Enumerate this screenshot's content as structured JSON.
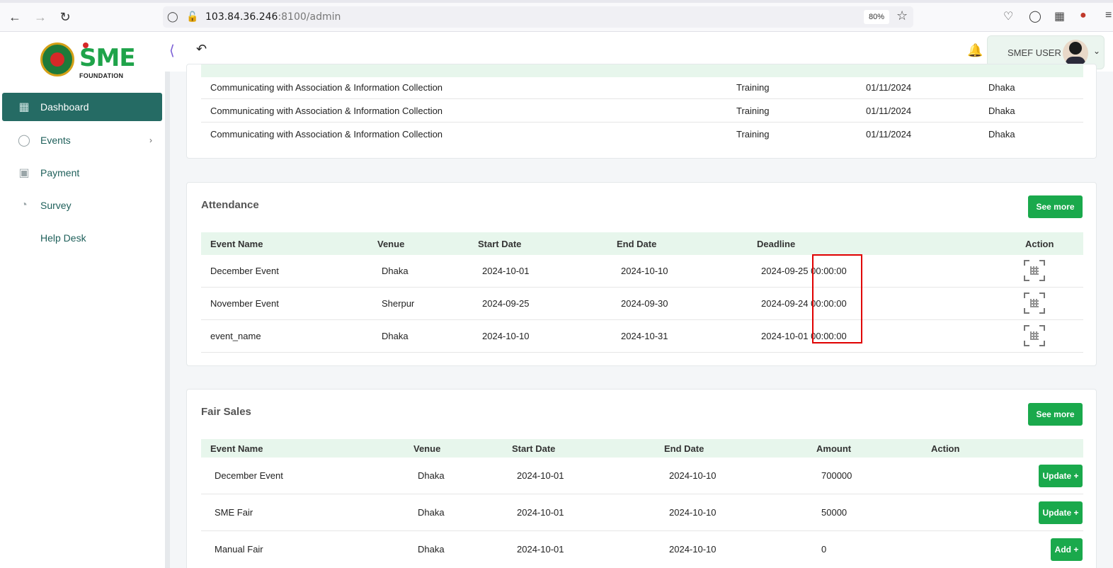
{
  "browser": {
    "url_host": "103.84.36.246",
    "url_rest": ":8100/admin",
    "zoom": "80%"
  },
  "sidebar": {
    "logo_text": "SME",
    "logo_sub": "FOUNDATION",
    "items": [
      {
        "label": "Dashboard",
        "icon": "grid-icon"
      },
      {
        "label": "Events",
        "icon": "lock-icon"
      },
      {
        "label": "Payment",
        "icon": "money-icon"
      },
      {
        "label": "Survey",
        "icon": "pie-chart-icon"
      },
      {
        "label": "Help Desk",
        "icon": ""
      }
    ]
  },
  "topbar": {
    "user_name": "SMEF USER"
  },
  "trainings": {
    "rows": [
      {
        "name": "Communicating with Association & Information Collection",
        "type": "Training",
        "date": "01/11/2024",
        "location": "Dhaka"
      },
      {
        "name": "Communicating with Association & Information Collection",
        "type": "Training",
        "date": "01/11/2024",
        "location": "Dhaka"
      },
      {
        "name": "Communicating with Association & Information Collection",
        "type": "Training",
        "date": "01/11/2024",
        "location": "Dhaka"
      }
    ]
  },
  "attendance": {
    "title": "Attendance",
    "see_more": "See more",
    "columns": [
      "Event Name",
      "Venue",
      "Start Date",
      "End Date",
      "Deadline",
      "Action"
    ],
    "rows": [
      {
        "event": "December Event",
        "venue": "Dhaka",
        "start": "2024-10-01",
        "end": "2024-10-10",
        "deadline_date": "2024-09-25",
        "deadline_time": "00:00:00"
      },
      {
        "event": "November Event",
        "venue": "Sherpur",
        "start": "2024-09-25",
        "end": "2024-09-30",
        "deadline_date": "2024-09-24",
        "deadline_time": "00:00:00"
      },
      {
        "event": "event_name",
        "venue": "Dhaka",
        "start": "2024-10-10",
        "end": "2024-10-31",
        "deadline_date": "2024-10-01",
        "deadline_time": "00:00:00"
      }
    ]
  },
  "fair_sales": {
    "title": "Fair Sales",
    "see_more": "See more",
    "columns": [
      "Event Name",
      "Venue",
      "Start Date",
      "End Date",
      "Amount",
      "Action"
    ],
    "rows": [
      {
        "event": "December Event",
        "venue": "Dhaka",
        "start": "2024-10-01",
        "end": "2024-10-10",
        "amount": "700000",
        "action": "Update +"
      },
      {
        "event": "SME Fair",
        "venue": "Dhaka",
        "start": "2024-10-01",
        "end": "2024-10-10",
        "amount": "50000",
        "action": "Update +"
      },
      {
        "event": "Manual Fair",
        "venue": "Dhaka",
        "start": "2024-10-01",
        "end": "2024-10-10",
        "amount": "0",
        "action": "Add +"
      }
    ]
  },
  "colors": {
    "accent": "#1aa94c",
    "sidebar_active": "#256b64",
    "table_header": "#e7f6ec",
    "highlight": "#e00000"
  }
}
